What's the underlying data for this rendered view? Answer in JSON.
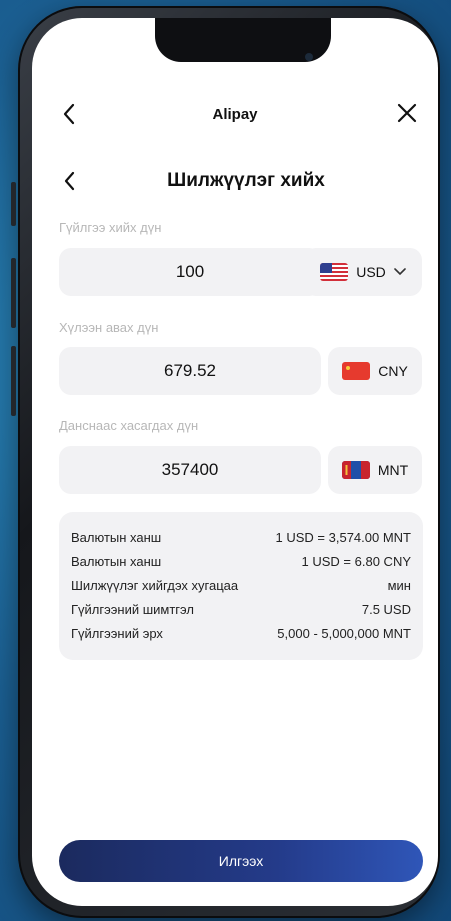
{
  "header": {
    "title": "Alipay",
    "back_icon": "chevron-left-icon",
    "close_icon": "close-icon"
  },
  "page": {
    "title": "Шилжүүлэг хийх",
    "back_icon": "chevron-left-icon"
  },
  "send": {
    "label": "Гүйлгээ хийх дүн",
    "amount": "100",
    "currency": "USD",
    "flag": "us-flag-icon"
  },
  "receive": {
    "label": "Хүлээн авах дүн",
    "amount": "679.52",
    "currency": "CNY",
    "flag": "cn-flag-icon"
  },
  "debit": {
    "label": "Данснаас хасагдах дүн",
    "amount": "357400",
    "currency": "MNT",
    "flag": "mn-flag-icon"
  },
  "info": [
    {
      "key": "Валютын ханш",
      "value": "1 USD = 3,574.00 MNT"
    },
    {
      "key": "Валютын ханш",
      "value": "1 USD = 6.80 CNY"
    },
    {
      "key": "Шилжүүлэг хийгдэх хугацаа",
      "value": "мин"
    },
    {
      "key": "Гүйлгээний шимтгэл",
      "value": "7.5 USD"
    },
    {
      "key": "Гүйлгээний эрх",
      "value": "5,000 - 5,000,000 MNT"
    }
  ],
  "submit_label": "Илгээх",
  "colors": {
    "button_start": "#1b2a5e",
    "button_end": "#2f56b8",
    "field_bg": "#f2f2f4"
  }
}
